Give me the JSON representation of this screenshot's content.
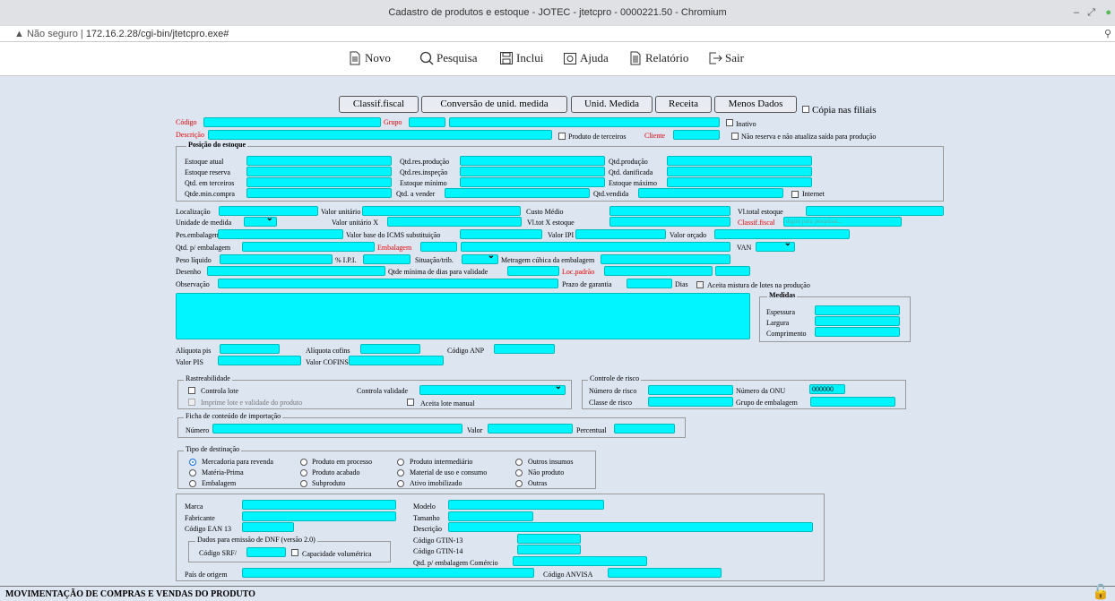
{
  "window": {
    "title": "Cadastro de produtos e estoque - JOTEC - jtetcpro - 0000221.50 - Chromium"
  },
  "address": {
    "warning": "Não seguro",
    "url": "172.16.2.28/cgi-bin/jtetcpro.exe#"
  },
  "toolbar": {
    "novo": "Novo",
    "pesquisa": "Pesquisa",
    "inclui": "Inclui",
    "ajuda": "Ajuda",
    "relatorio": "Relatório",
    "sair": "Sair"
  },
  "buttons": {
    "classif": "Classif.fiscal",
    "conversao": "Conversão de unid. medida",
    "unid": "Unid. Medida",
    "receita": "Receita",
    "menos": "Menos Dados",
    "copia": "Cópia nas filiais"
  },
  "labels": {
    "codigo": "Código",
    "grupo": "Grupo",
    "inativo": "Inativo",
    "descricao": "Descrição",
    "terceiros": "Produto de terceiros",
    "cliente": "Cliente",
    "naoreserva": "Não reserva e não atualiza saída para produção",
    "posicao": "Posição do estoque",
    "estoque_atual": "Estoque atual",
    "qtd_res_prod": "Qtd.res.produção",
    "qtd_producao": "Qtd.produção",
    "estoque_reserva": "Estoque reserva",
    "qtd_res_insp": "Qtd.res.inspeção",
    "qtd_danif": "Qtd. danificada",
    "qtd_terceiros": "Qtd. em terceiros",
    "estoque_min": "Estoque mínimo",
    "estoque_max": "Estoque máximo",
    "qtde_min_compra": "Qtde.min.compra",
    "qtd_vender": "Qtd. a vender",
    "qtd_vendida": "Qtd.vendida",
    "internet": "Internet",
    "localizacao": "Localização",
    "valor_unit": "Valor unitário",
    "custo_medio": "Custo Médio",
    "vl_total_estoque": "Vl.total estoque",
    "unidade": "Unidade de medida",
    "valor_unit_x": "Valor unitário X",
    "vl_tot_x": "Vl.tot X estoque",
    "classif_fiscal": "Classif.fiscal",
    "classif_placeholder": "digite para pesquisar...",
    "pes_emb": "Pes.embalagem",
    "valor_base": "Valor base do ICMS substituição",
    "valor_ipi": "Valor IPI",
    "valor_orcado": "Valor orçado",
    "qtd_emb": "Qtd. p/ embalagem",
    "embalagem": "Embalagem",
    "van": "VAN",
    "peso": "Peso líquido",
    "ipi": "% I.P.I.",
    "situacao": "Situação/trib.",
    "metragem": "Metragem cúbica da embalagem",
    "desenho": "Desenho",
    "qtde_min_dias": "Qtde mínima de dias para validade",
    "loc_padrao": "Loc.padrão",
    "observacao": "Observação",
    "prazo": "Prazo de garantia",
    "dias": "Dias",
    "aceita_mistura": "Aceita mistura de lotes na produção",
    "medidas": "Medidas",
    "espessura": "Espessura",
    "largura": "Largura",
    "comprimento": "Comprimento",
    "aliq_pis": "Alíquota pis",
    "aliq_cofins": "Alíquota cofins",
    "codigo_anp": "Código ANP",
    "valor_pis": "Valor PIS",
    "valor_cofins": "Valor COFINS",
    "rastreab": "Rastreabilidade",
    "controla_lote": "Controla lote",
    "controla_validade": "Controla validade",
    "imprime_lote": "Imprime lote e validade do produto",
    "aceita_lote": "Aceita lote manual",
    "controle_risco": "Controle de risco",
    "numero_risco": "Número de risco",
    "numero_onu": "Número da ONU",
    "onu_value": "000000",
    "classe_risco": "Classe de risco",
    "grupo_emb": "Grupo de embalagem",
    "ficha": "Ficha de conteúdo de importação",
    "numero": "Número",
    "valor": "Valor",
    "percentual": "Percentual",
    "tipo_dest": "Tipo de destinação",
    "marca": "Marca",
    "modelo": "Modelo",
    "fabricante": "Fabricante",
    "tamanho": "Tamanho",
    "ean": "Código EAN 13",
    "descricao2": "Descrição",
    "dnf": "Dados para emissão de DNF (versão 2.0)",
    "gtin13": "Código GTIN-13",
    "codigo_srf": "Código SRF/",
    "cap_vol": "Capacidade volumétrica",
    "gtin14": "Código GTIN-14",
    "qtd_emb_com": "Qtd. p/ embalagem Comércio",
    "pais": "País de origem",
    "anvisa": "Código ANVISA"
  },
  "destinacao": [
    "Mercadoria para revenda",
    "Produto em processo",
    "Produto intermediário",
    "Outros insumos",
    "Matéria-Prima",
    "Produto acabado",
    "Material de uso e consumo",
    "Não produto",
    "Embalagem",
    "Subproduto",
    "Ativo imobilizado",
    "Outras"
  ],
  "bottom": {
    "title": "MOVIMENTAÇÃO DE COMPRAS E VENDAS DO PRODUTO"
  }
}
